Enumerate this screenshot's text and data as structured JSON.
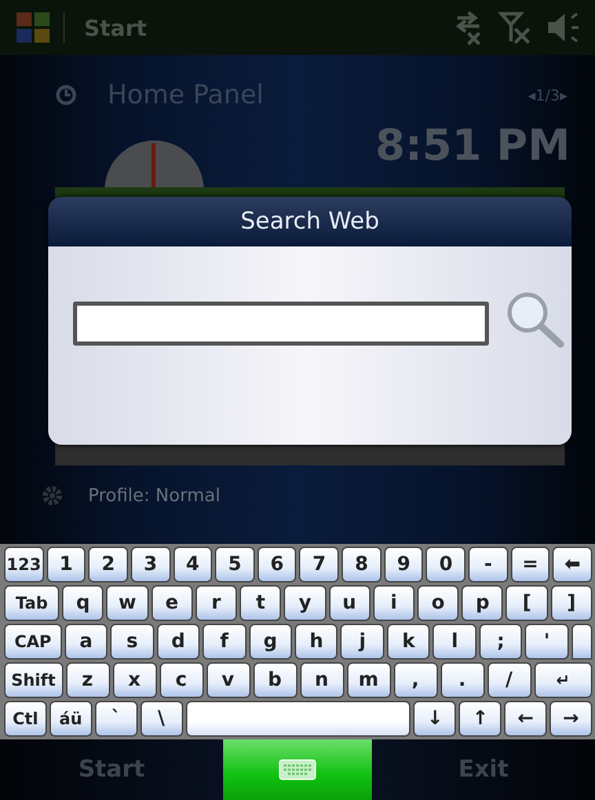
{
  "status_bar": {
    "title": "Start"
  },
  "home_panel": {
    "title": "Home Panel",
    "page_indicator": "◂1/3▸",
    "time": "8:51 PM",
    "profile": "Profile: Normal"
  },
  "dialog": {
    "title": "Search Web"
  },
  "keyboard": {
    "key_lines": [
      [
        {
          "label": "123",
          "kind": "key"
        },
        {
          "label": "1",
          "kind": "key"
        },
        {
          "label": "2",
          "kind": "key"
        },
        {
          "label": "3",
          "kind": "key"
        },
        {
          "label": "4",
          "kind": "key"
        },
        {
          "label": "5",
          "kind": "key"
        },
        {
          "label": "6",
          "kind": "key"
        },
        {
          "label": "7",
          "kind": "key"
        },
        {
          "label": "8",
          "kind": "key"
        },
        {
          "label": "9",
          "kind": "key"
        },
        {
          "label": "0",
          "kind": "key"
        },
        {
          "label": "-",
          "kind": "key"
        },
        {
          "label": "=",
          "kind": "key"
        },
        {
          "label": "⬅",
          "kind": "key"
        }
      ],
      [
        {
          "label": "Tab",
          "kind": "wide"
        },
        {
          "label": "q",
          "kind": "key"
        },
        {
          "label": "w",
          "kind": "key"
        },
        {
          "label": "e",
          "kind": "key"
        },
        {
          "label": "r",
          "kind": "key"
        },
        {
          "label": "t",
          "kind": "key"
        },
        {
          "label": "y",
          "kind": "key"
        },
        {
          "label": "u",
          "kind": "key"
        },
        {
          "label": "i",
          "kind": "key"
        },
        {
          "label": "o",
          "kind": "key"
        },
        {
          "label": "p",
          "kind": "key"
        },
        {
          "label": "[",
          "kind": "key"
        },
        {
          "label": "]",
          "kind": "key"
        }
      ],
      [
        {
          "label": "CAP",
          "kind": "wide"
        },
        {
          "label": "a",
          "kind": "key"
        },
        {
          "label": "s",
          "kind": "key"
        },
        {
          "label": "d",
          "kind": "key"
        },
        {
          "label": "f",
          "kind": "key"
        },
        {
          "label": "g",
          "kind": "key"
        },
        {
          "label": "h",
          "kind": "key"
        },
        {
          "label": "j",
          "kind": "key"
        },
        {
          "label": "k",
          "kind": "key"
        },
        {
          "label": "l",
          "kind": "key"
        },
        {
          "label": ";",
          "kind": "key"
        },
        {
          "label": "'",
          "kind": "key"
        },
        {
          "kind": "enter_top"
        }
      ],
      [
        {
          "label": "Shift",
          "kind": "wide"
        },
        {
          "label": "z",
          "kind": "key"
        },
        {
          "label": "x",
          "kind": "key"
        },
        {
          "label": "c",
          "kind": "key"
        },
        {
          "label": "v",
          "kind": "key"
        },
        {
          "label": "b",
          "kind": "key"
        },
        {
          "label": "n",
          "kind": "key"
        },
        {
          "label": "m",
          "kind": "key"
        },
        {
          "label": ",",
          "kind": "key"
        },
        {
          "label": ".",
          "kind": "key"
        },
        {
          "label": "/",
          "kind": "key"
        },
        {
          "label": "↵",
          "kind": "wide"
        }
      ],
      [
        {
          "label": "Ctl",
          "kind": "key"
        },
        {
          "label": "áü",
          "kind": "key"
        },
        {
          "label": "`",
          "kind": "key"
        },
        {
          "label": "\\",
          "kind": "key"
        },
        {
          "kind": "space"
        },
        {
          "label": "↓",
          "kind": "key"
        },
        {
          "label": "↑",
          "kind": "key"
        },
        {
          "label": "←",
          "kind": "key"
        },
        {
          "label": "→",
          "kind": "key"
        }
      ]
    ]
  },
  "soft_keys": {
    "left": "Start",
    "right": "Exit",
    "input_panel": {
      "active": true
    }
  }
}
